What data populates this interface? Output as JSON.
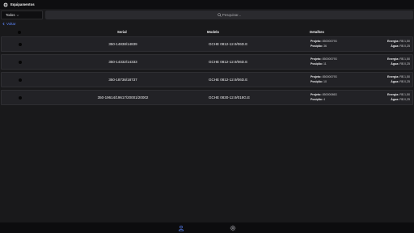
{
  "app": {
    "title": "Equipamentos"
  },
  "filter": {
    "value": "Todos"
  },
  "search": {
    "placeholder": "Pesquisar..."
  },
  "nav": {
    "back_label": "Voltar"
  },
  "table": {
    "headers": {
      "serial": "Serial",
      "model": "Modelo",
      "details": "Detalhes"
    },
    "rows": [
      {
        "serial": "350-14838/14839",
        "model": "GCHE 0812-12.9/06D.E",
        "project_label": "Projeto:",
        "project": "850000793",
        "position_label": "Posição:",
        "position": "36",
        "energy_label": "Energia:",
        "energy": "R$ 1,50",
        "water_label": "Água:",
        "water": "R$ 0,25"
      },
      {
        "serial": "350-14332/14333",
        "model": "GCHE 0812-12.9/06D.E",
        "project_label": "Projeto:",
        "project": "850000793",
        "position_label": "Posição:",
        "position": "11",
        "energy_label": "Energia:",
        "energy": "R$ 1,50",
        "water_label": "Água:",
        "water": "R$ 0,25"
      },
      {
        "serial": "350-18736/18737",
        "model": "GCHE 0812-12.9/06D.E",
        "project_label": "Projeto:",
        "project": "850000793",
        "position_label": "Posição:",
        "position": "10",
        "energy_label": "Energia:",
        "energy": "R$ 1,50",
        "water_label": "Água:",
        "water": "R$ 0,25"
      },
      {
        "serial": "350-19614/19617/20001/20002",
        "model": "GCHE 0830-12.9/018G.E",
        "project_label": "Projeto:",
        "project": "850000863",
        "position_label": "Posição:",
        "position": "4",
        "energy_label": "Energia:",
        "energy": "R$ 1,50",
        "water_label": "Água:",
        "water": "R$ 0,25"
      }
    ]
  },
  "bottom_nav": {
    "items": [
      {
        "icon": "user-icon",
        "active": true
      },
      {
        "icon": "gear-icon",
        "active": false
      }
    ]
  },
  "colors": {
    "accent": "#5d87ff",
    "background": "#19191b",
    "row": "#222226",
    "topbar": "#0e0e10"
  }
}
